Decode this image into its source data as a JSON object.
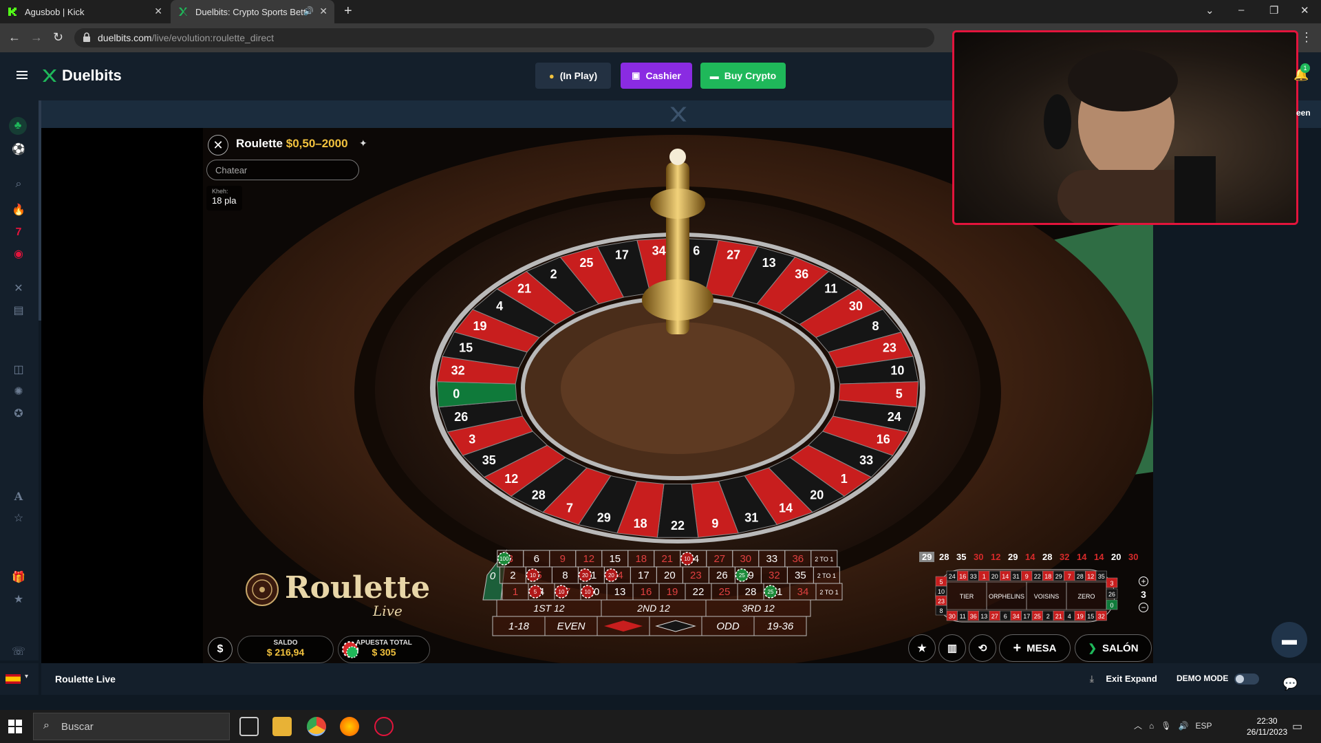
{
  "browser": {
    "tabs": [
      {
        "title": "Agusbob | Kick",
        "icon": "kick-icon"
      },
      {
        "title": "Duelbits: Crypto Sports Betti",
        "icon": "duelbits-icon",
        "audio": "speaker-icon"
      }
    ],
    "url_host": "duelbits.com",
    "url_path": "/live/evolution:roulette_direct"
  },
  "site": {
    "brand": "Duelbits",
    "in_play_label": "(In Play)",
    "cashier_label": "Cashier",
    "buy_crypto_label": "Buy Crypto",
    "notification_count": "1",
    "right_rail_label": "een",
    "accent_green": "#1fb85a",
    "accent_purple": "#8a2be2"
  },
  "game": {
    "title": "Roulette",
    "limits": "$0,50–2000",
    "chat_placeholder": "Chatear",
    "chat_message": {
      "user": "Kheh:",
      "text": "18 pla"
    },
    "logo_main": "Roulette",
    "logo_sub": "Live",
    "balance_label": "SALDO",
    "balance_value": "$ 216,94",
    "total_bet_label": "APUESTA TOTAL",
    "total_bet_value": "$ 305",
    "mesa_label": "MESA",
    "salon_label": "SALÓN",
    "wheel_numbers": [
      "6",
      "27",
      "13",
      "36",
      "11",
      "30",
      "8",
      "23",
      "10",
      "5",
      "24",
      "16",
      "33",
      "1",
      "20",
      "14",
      "31",
      "9",
      "22",
      "18",
      "29",
      "7",
      "28",
      "12",
      "35",
      "3",
      "26",
      "0",
      "32",
      "15",
      "19",
      "4",
      "21",
      "2",
      "25",
      "17",
      "34"
    ],
    "history": [
      {
        "n": "29",
        "c": "#ffffff",
        "hl": true
      },
      {
        "n": "28",
        "c": "#ffffff"
      },
      {
        "n": "35",
        "c": "#ffffff"
      },
      {
        "n": "30",
        "c": "#d62a2a"
      },
      {
        "n": "12",
        "c": "#d62a2a"
      },
      {
        "n": "29",
        "c": "#ffffff"
      },
      {
        "n": "14",
        "c": "#d62a2a"
      },
      {
        "n": "28",
        "c": "#ffffff"
      },
      {
        "n": "32",
        "c": "#d62a2a"
      },
      {
        "n": "14",
        "c": "#d62a2a"
      },
      {
        "n": "14",
        "c": "#d62a2a"
      },
      {
        "n": "20",
        "c": "#ffffff"
      },
      {
        "n": "30",
        "c": "#d62a2a"
      }
    ],
    "racetrack_top": [
      "24",
      "16",
      "33",
      "1",
      "20",
      "14",
      "31",
      "9",
      "22",
      "18",
      "29",
      "7",
      "28",
      "12",
      "35"
    ],
    "racetrack_bottom": [
      "30",
      "11",
      "36",
      "13",
      "27",
      "6",
      "34",
      "17",
      "25",
      "2",
      "21",
      "4",
      "19",
      "15",
      "32"
    ],
    "racetrack_left": [
      "5",
      "10",
      "23",
      "8"
    ],
    "racetrack_right": [
      "3",
      "26",
      "0"
    ],
    "racetrack_sections": [
      "TIER",
      "ORPHELINS",
      "VOISINS",
      "ZERO"
    ],
    "neighbours_count": "3",
    "table": {
      "zero": "0",
      "rows": [
        [
          "3",
          "6",
          "9",
          "12",
          "15",
          "18",
          "21",
          "24",
          "27",
          "30",
          "33",
          "36"
        ],
        [
          "2",
          "5",
          "8",
          "11",
          "14",
          "17",
          "20",
          "23",
          "26",
          "29",
          "32",
          "35"
        ],
        [
          "1",
          "4",
          "7",
          "10",
          "13",
          "16",
          "19",
          "22",
          "25",
          "28",
          "31",
          "34"
        ]
      ],
      "column_label": "2 TO 1",
      "dozens": [
        "1ST 12",
        "2ND 12",
        "3RD 12"
      ],
      "outside": [
        "1-18",
        "EVEN",
        "",
        "",
        "ODD",
        "19-36"
      ],
      "chips_on": {
        "3": "100",
        "29": "25",
        "5": "10",
        "7": "10",
        "24": "10",
        "10": "10",
        "11": "20",
        "14": "20",
        "31": "25",
        "4": "5"
      },
      "red_numbers": [
        1,
        3,
        5,
        7,
        9,
        12,
        14,
        16,
        18,
        19,
        21,
        23,
        25,
        27,
        30,
        32,
        34,
        36
      ]
    }
  },
  "bottom_bar": {
    "game_name": "Roulette Live",
    "exit_expand": "Exit Expand",
    "demo_mode": "DEMO MODE"
  },
  "taskbar": {
    "search_placeholder": "Buscar",
    "language": "ESP",
    "time": "22:30",
    "date": "26/11/2023"
  }
}
